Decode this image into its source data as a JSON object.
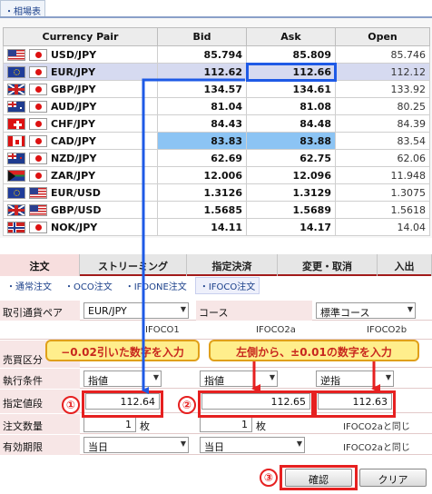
{
  "window": {
    "tab_label": "相場表"
  },
  "rates": {
    "headers": {
      "pair": "Currency Pair",
      "bid": "Bid",
      "ask": "Ask",
      "open": "Open"
    },
    "rows": [
      {
        "pair": "USD/JPY",
        "bid": "85.794",
        "ask": "85.809",
        "open": "85.746",
        "flags": [
          "us",
          "jp"
        ]
      },
      {
        "pair": "EUR/JPY",
        "bid": "112.62",
        "ask": "112.66",
        "open": "112.12",
        "flags": [
          "eu",
          "jp"
        ]
      },
      {
        "pair": "GBP/JPY",
        "bid": "134.57",
        "ask": "134.61",
        "open": "133.92",
        "flags": [
          "gb",
          "jp"
        ]
      },
      {
        "pair": "AUD/JPY",
        "bid": "81.04",
        "ask": "81.08",
        "open": "80.25",
        "flags": [
          "au",
          "jp"
        ]
      },
      {
        "pair": "CHF/JPY",
        "bid": "84.43",
        "ask": "84.48",
        "open": "84.39",
        "flags": [
          "ch",
          "jp"
        ]
      },
      {
        "pair": "CAD/JPY",
        "bid": "83.83",
        "ask": "83.88",
        "open": "83.54",
        "flags": [
          "ca",
          "jp"
        ]
      },
      {
        "pair": "NZD/JPY",
        "bid": "62.69",
        "ask": "62.75",
        "open": "62.06",
        "flags": [
          "nz",
          "jp"
        ]
      },
      {
        "pair": "ZAR/JPY",
        "bid": "12.006",
        "ask": "12.096",
        "open": "11.948",
        "flags": [
          "za",
          "jp"
        ]
      },
      {
        "pair": "EUR/USD",
        "bid": "1.3126",
        "ask": "1.3129",
        "open": "1.3075",
        "flags": [
          "eu",
          "us"
        ]
      },
      {
        "pair": "GBP/USD",
        "bid": "1.5685",
        "ask": "1.5689",
        "open": "1.5618",
        "flags": [
          "gb",
          "us"
        ]
      },
      {
        "pair": "NOK/JPY",
        "bid": "14.11",
        "ask": "14.17",
        "open": "14.04",
        "flags": [
          "no",
          "jp"
        ]
      }
    ]
  },
  "order": {
    "tabs": [
      "注文",
      "ストリーミング",
      "指定決済",
      "変更・取消",
      "入出"
    ],
    "subtabs": [
      "通常注文",
      "OCO注文",
      "IFDONE注文",
      "IFOCO注文"
    ],
    "labels": {
      "pair": "取引通貨ペア",
      "side": "売買区分",
      "condition": "執行条件",
      "price": "指定値段",
      "quantity": "注文数量",
      "expiry": "有効期限"
    },
    "pair_value": "EUR/JPY",
    "course_label": "コース",
    "course_value": "標準コース",
    "col_headers": [
      "IFOCO1",
      "IFOCO2a",
      "IFOCO2b"
    ],
    "conditions": [
      "指値",
      "指値",
      "逆指"
    ],
    "prices": [
      "112.64",
      "112.65",
      "112.63"
    ],
    "quantity_value": "1",
    "quantity_unit": "枚",
    "same_as_text": "IFOCO2aと同じ",
    "expiry_values": [
      "当日",
      "当日"
    ],
    "confirm_button": "確認",
    "clear_button": "クリア"
  },
  "annotations": {
    "callout_left": "−0.02引いた数字を入力",
    "callout_right": "左側から、±0.01の数字を入力",
    "markers": [
      "①",
      "②",
      "③"
    ]
  },
  "colors": {
    "highlight_blue": "#1e5ae6",
    "annotation_red": "#e62020",
    "callout_fill": "#ffee8c"
  }
}
